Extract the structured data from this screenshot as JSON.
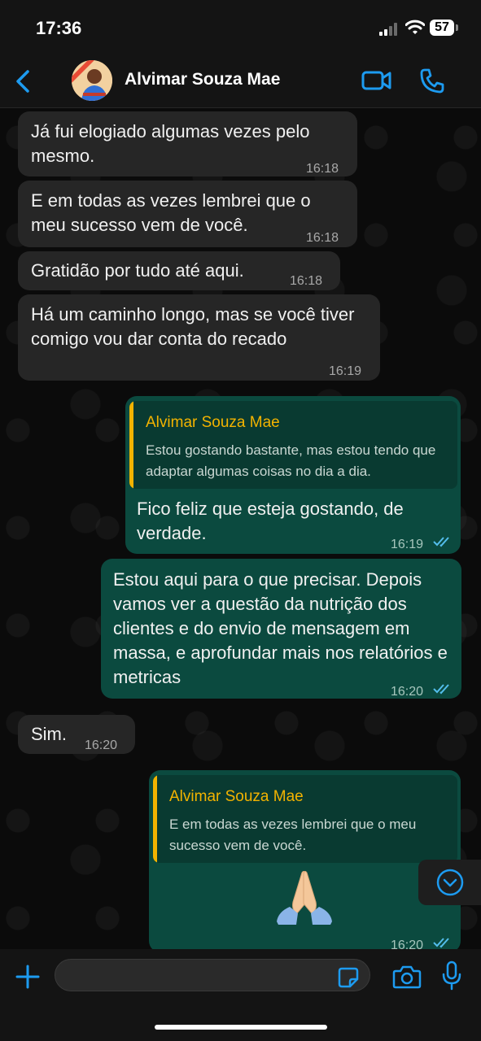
{
  "status_bar": {
    "time": "17:36",
    "battery": "57"
  },
  "header": {
    "contact_name": "Alvimar Souza Mae"
  },
  "messages": [
    {
      "text": "Já fui elogiado algumas vezes pelo mesmo.",
      "time": "16:18"
    },
    {
      "text": "E em todas as vezes lembrei que o meu sucesso vem de você.",
      "time": "16:18"
    },
    {
      "text": "Gratidão por tudo até aqui.",
      "time": "16:18"
    },
    {
      "text": "Há um caminho longo, mas se você tiver comigo vou dar conta do recado",
      "time": "16:19"
    },
    {
      "quote_name": "Alvimar Souza Mae",
      "quote_text": "Estou gostando bastante, mas estou tendo que adaptar algumas coisas no dia a dia.",
      "text": "Fico feliz que esteja gostando, de verdade.",
      "time": "16:19"
    },
    {
      "text": "Estou aqui para o que precisar. Depois vamos ver a questão da nutrição dos clientes e do envio de mensagem em massa, e aprofundar mais nos relatórios e metricas",
      "time": "16:20"
    },
    {
      "text": "Sim.",
      "time": "16:20"
    },
    {
      "quote_name": "Alvimar Souza Mae",
      "quote_text": "E em todas as vezes lembrei que o meu sucesso vem de você.",
      "emoji": "folded-hands",
      "time": "16:20"
    }
  ],
  "colors": {
    "accent": "#1d9bf0",
    "outgoing_bubble": "#0b4a3f",
    "incoming_bubble": "#262626",
    "quote_name": "#f3b300"
  },
  "icons": [
    "back-chevron-icon",
    "video-call-icon",
    "phone-icon",
    "plus-icon",
    "sticker-icon",
    "camera-icon",
    "microphone-icon",
    "scroll-down-icon",
    "read-ticks-icon"
  ],
  "composer": {
    "placeholder": ""
  }
}
